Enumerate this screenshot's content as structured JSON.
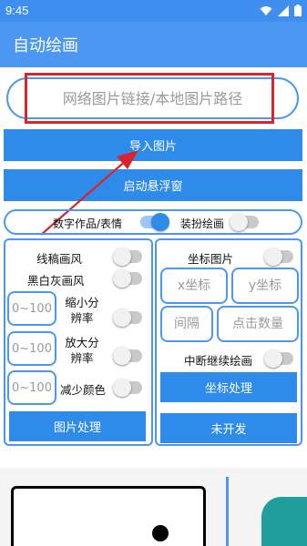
{
  "status_bar": {
    "time": "9:45"
  },
  "app_bar": {
    "title": "自动绘画"
  },
  "url_input": {
    "placeholder": "网络图片链接/本地图片路径"
  },
  "buttons": {
    "import": "导入图片",
    "floating_window": "启动悬浮窗"
  },
  "mode_toggle": {
    "left_label": "数字作品/表情",
    "left_on": true,
    "right_label": "装扮绘画",
    "right_on": false
  },
  "left_panel": {
    "line_art": {
      "label": "线稿画风",
      "on": false
    },
    "grayscale": {
      "label": "黑白灰画风",
      "on": false
    },
    "shrink": {
      "placeholder": "0~100",
      "label": "缩小分辨率",
      "on": false
    },
    "enlarge": {
      "placeholder": "0~100",
      "label": "放大分辨率",
      "on": false
    },
    "reduce_colors": {
      "placeholder": "0~100",
      "label": "减少颜色",
      "on": false
    },
    "process_button": "图片处理"
  },
  "right_panel": {
    "coord_image": {
      "label": "坐标图片",
      "on": false
    },
    "x_coord": {
      "placeholder": "x坐标"
    },
    "y_coord": {
      "placeholder": "y坐标"
    },
    "interval": {
      "placeholder": "间隔"
    },
    "click_count": {
      "placeholder": "点击数量"
    },
    "resume": {
      "label": "中断继续绘画",
      "on": false
    },
    "coord_button": "坐标处理",
    "undeveloped_button": "未开发"
  },
  "colors": {
    "primary": "#2f8bea",
    "app_bar": "#4b97f2",
    "highlight_box": "#d9232d",
    "teal": "#1f9e9c"
  }
}
